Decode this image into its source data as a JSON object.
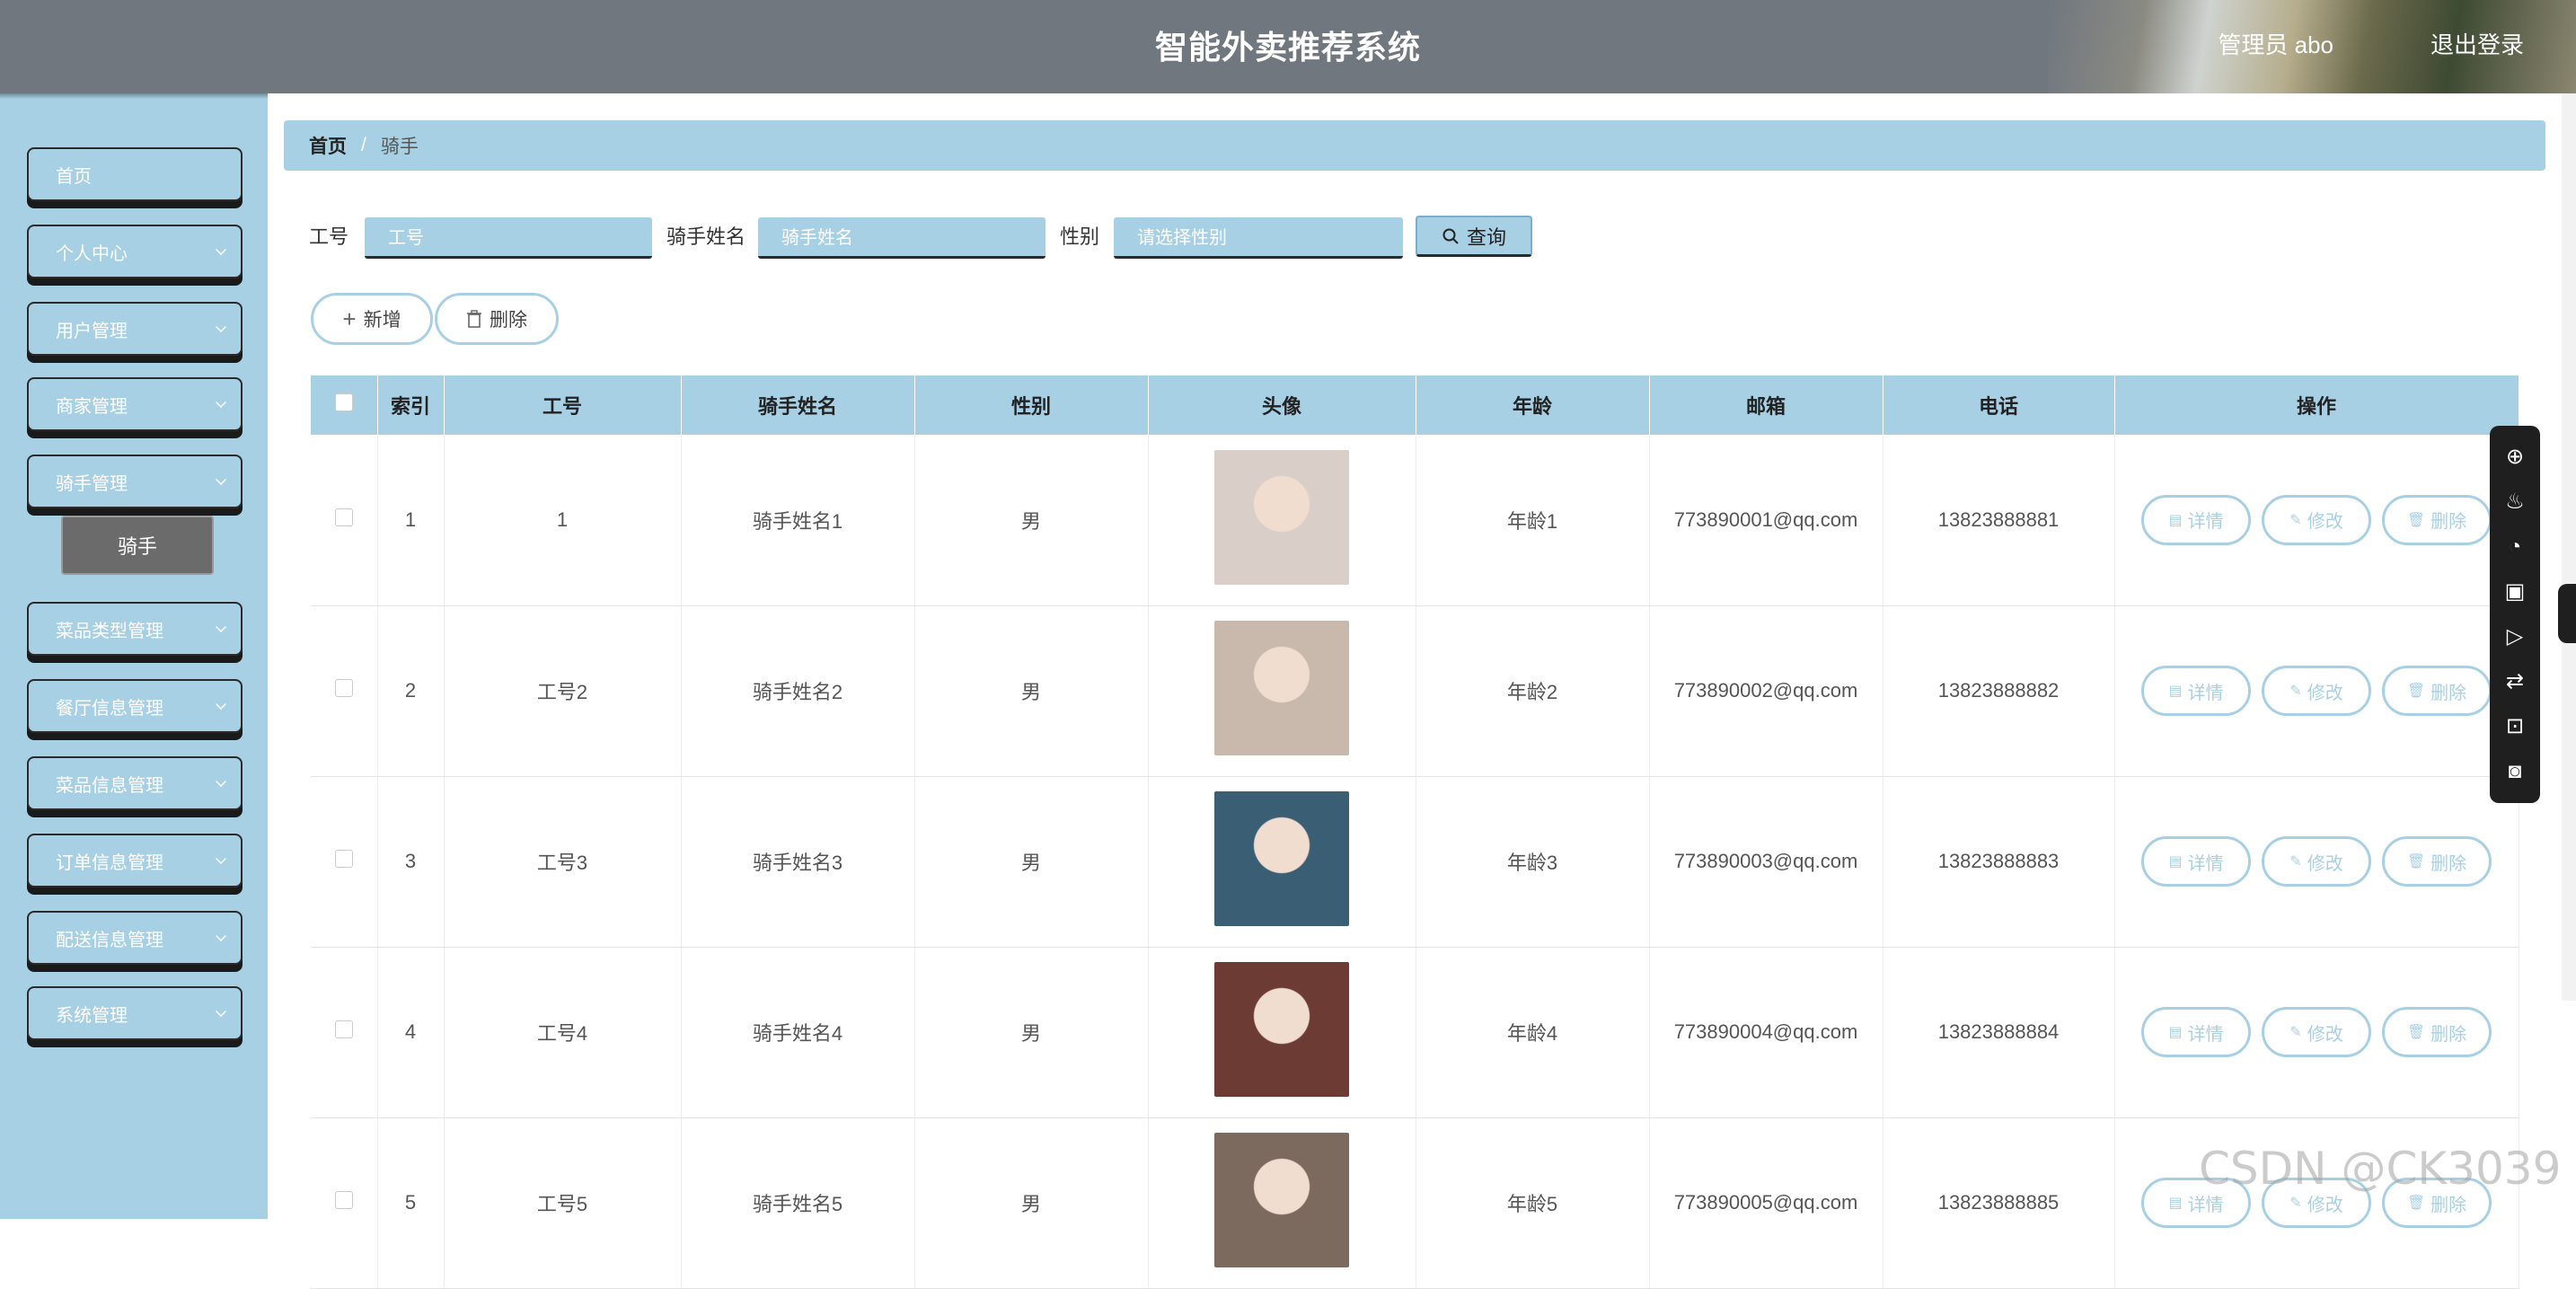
{
  "header": {
    "title": "智能外卖推荐系统",
    "user_label": "管理员 abo",
    "logout_label": "退出登录"
  },
  "sidebar": {
    "items": [
      {
        "label": "首页",
        "has_children": false
      },
      {
        "label": "个人中心",
        "has_children": true
      },
      {
        "label": "用户管理",
        "has_children": true
      },
      {
        "label": "商家管理",
        "has_children": true
      },
      {
        "label": "骑手管理",
        "has_children": true
      },
      {
        "label": "菜品类型管理",
        "has_children": true
      },
      {
        "label": "餐厅信息管理",
        "has_children": true
      },
      {
        "label": "菜品信息管理",
        "has_children": true
      },
      {
        "label": "订单信息管理",
        "has_children": true
      },
      {
        "label": "配送信息管理",
        "has_children": true
      },
      {
        "label": "系统管理",
        "has_children": true
      }
    ],
    "sub_item": "骑手"
  },
  "breadcrumb": {
    "home": "首页",
    "separator": "/",
    "current": "骑手"
  },
  "filters": {
    "job_no_label": "工号",
    "job_no_placeholder": "工号",
    "name_label": "骑手姓名",
    "name_placeholder": "骑手姓名",
    "gender_label": "性别",
    "gender_placeholder": "请选择性别",
    "search_label": "查询"
  },
  "actions": {
    "add_label": "新增",
    "delete_label": "删除"
  },
  "table": {
    "columns": [
      "索引",
      "工号",
      "骑手姓名",
      "性别",
      "头像",
      "年龄",
      "邮箱",
      "电话",
      "操作"
    ],
    "op_labels": {
      "detail": "详情",
      "edit": "修改",
      "delete": "删除"
    },
    "rows": [
      {
        "index": "1",
        "job_no": "1",
        "name": "骑手姓名1",
        "gender": "男",
        "age": "年龄1",
        "email": "773890001@qq.com",
        "phone": "13823888881",
        "avatar_color": "#d9cfc8"
      },
      {
        "index": "2",
        "job_no": "工号2",
        "name": "骑手姓名2",
        "gender": "男",
        "age": "年龄2",
        "email": "773890002@qq.com",
        "phone": "13823888882",
        "avatar_color": "#c9b8ac"
      },
      {
        "index": "3",
        "job_no": "工号3",
        "name": "骑手姓名3",
        "gender": "男",
        "age": "年龄3",
        "email": "773890003@qq.com",
        "phone": "13823888883",
        "avatar_color": "#3a5f74"
      },
      {
        "index": "4",
        "job_no": "工号4",
        "name": "骑手姓名4",
        "gender": "男",
        "age": "年龄4",
        "email": "773890004@qq.com",
        "phone": "13823888884",
        "avatar_color": "#6b3b34"
      },
      {
        "index": "5",
        "job_no": "工号5",
        "name": "骑手姓名5",
        "gender": "男",
        "age": "年龄5",
        "email": "773890005@qq.com",
        "phone": "13823888885",
        "avatar_color": "#7c6a5e"
      }
    ]
  },
  "watermark": "CSDN @CK3039",
  "colors": {
    "accent": "#a8d0e4",
    "header": "#70777f",
    "dark_border": "#2a2a2a"
  }
}
